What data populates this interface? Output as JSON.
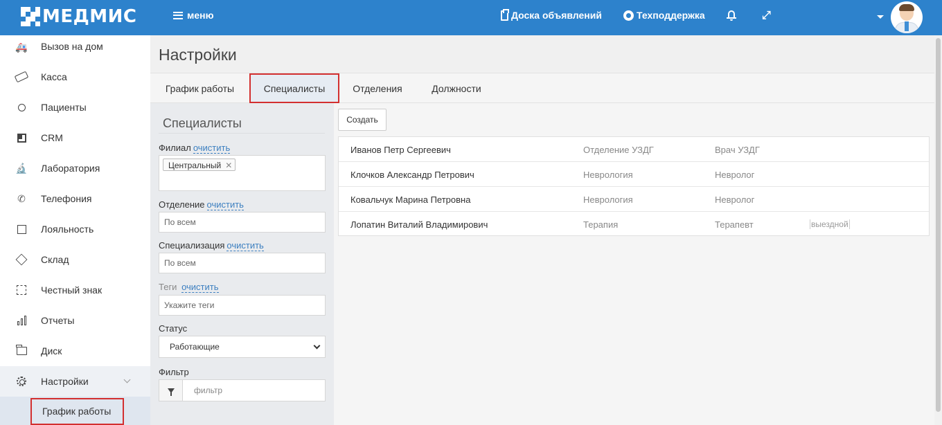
{
  "header": {
    "logo_text": "МЕДМИС",
    "menu_label": "меню",
    "board_label": "Доска объявлений",
    "support_label": "Техподдержка"
  },
  "sidebar": {
    "items": [
      {
        "label": "Вызов на дом",
        "icon": "ambulance-icon"
      },
      {
        "label": "Касса",
        "icon": "cash-icon"
      },
      {
        "label": "Пациенты",
        "icon": "patients-icon"
      },
      {
        "label": "CRM",
        "icon": "crm-icon"
      },
      {
        "label": "Лаборатория",
        "icon": "microscope-icon"
      },
      {
        "label": "Телефония",
        "icon": "phone-icon"
      },
      {
        "label": "Лояльность",
        "icon": "gift-icon"
      },
      {
        "label": "Склад",
        "icon": "box-icon"
      },
      {
        "label": "Честный знак",
        "icon": "scan-icon"
      },
      {
        "label": "Отчеты",
        "icon": "bar-chart-icon"
      },
      {
        "label": "Диск",
        "icon": "folder-icon"
      },
      {
        "label": "Настройки",
        "icon": "gear-icon"
      }
    ],
    "sub_item": "График работы"
  },
  "main": {
    "title": "Настройки",
    "tabs": [
      "График работы",
      "Специалисты",
      "Отделения",
      "Должности"
    ],
    "active_tab": "Специалисты"
  },
  "filters": {
    "title": "Специалисты",
    "branch_label": "Филиал",
    "clear": "очистить",
    "branch_tag": "Центральный",
    "department_label": "Отделение",
    "department_value": "По всем",
    "specialization_label": "Специализация",
    "specialization_value": "По всем",
    "tags_label": "Теги",
    "tags_placeholder": "Укажите теги",
    "status_label": "Статус",
    "status_value": "Работающие",
    "filter_label": "Фильтр",
    "filter_placeholder": "фильтр"
  },
  "content": {
    "create_label": "Создать",
    "specialists": [
      {
        "name": "Иванов Петр Сергеевич",
        "department": "Отделение УЗДГ",
        "position": "Врач УЗДГ",
        "tag": ""
      },
      {
        "name": "Клочков Александр Петрович",
        "department": "Неврология",
        "position": "Невролог",
        "tag": ""
      },
      {
        "name": "Ковальчук Марина Петровна",
        "department": "Неврология",
        "position": "Невролог",
        "tag": ""
      },
      {
        "name": "Лопатин Виталий Владимирович",
        "department": "Терапия",
        "position": "Терапевт",
        "tag": "выездной"
      }
    ]
  },
  "colors": {
    "brand": "#2d82cc",
    "highlight_border": "#d32f2f",
    "link": "#3c7fc0"
  }
}
